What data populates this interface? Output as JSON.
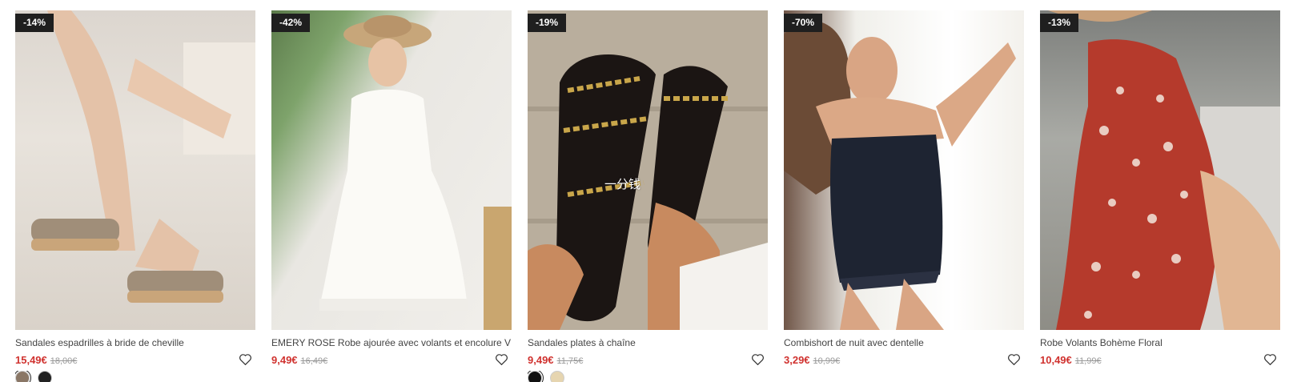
{
  "products": [
    {
      "badge": "-14%",
      "title": "Sandales espadrilles à bride de cheville",
      "price": "15,49€",
      "old_price": "18,00€",
      "swatches": [
        "#8a7766",
        "#222222"
      ]
    },
    {
      "badge": "-42%",
      "title": "EMERY ROSE Robe ajourée avec volants et encolure V",
      "price": "9,49€",
      "old_price": "16,49€",
      "swatches": []
    },
    {
      "badge": "-19%",
      "title": "Sandales plates à chaîne",
      "price": "9,49€",
      "old_price": "11,75€",
      "swatches": [
        "#111111",
        "#e6d5b0"
      ],
      "watermark": "一分钱"
    },
    {
      "badge": "-70%",
      "title": "Combishort de nuit avec dentelle",
      "price": "3,29€",
      "old_price": "10,99€",
      "swatches": []
    },
    {
      "badge": "-13%",
      "title": "Robe Volants Bohème Floral",
      "price": "10,49€",
      "old_price": "11,99€",
      "swatches": []
    }
  ],
  "colors": {
    "price": "#d0322f",
    "badge_bg": "#1f1f1f"
  },
  "icons": {
    "wishlist": "heart-outline-icon"
  }
}
